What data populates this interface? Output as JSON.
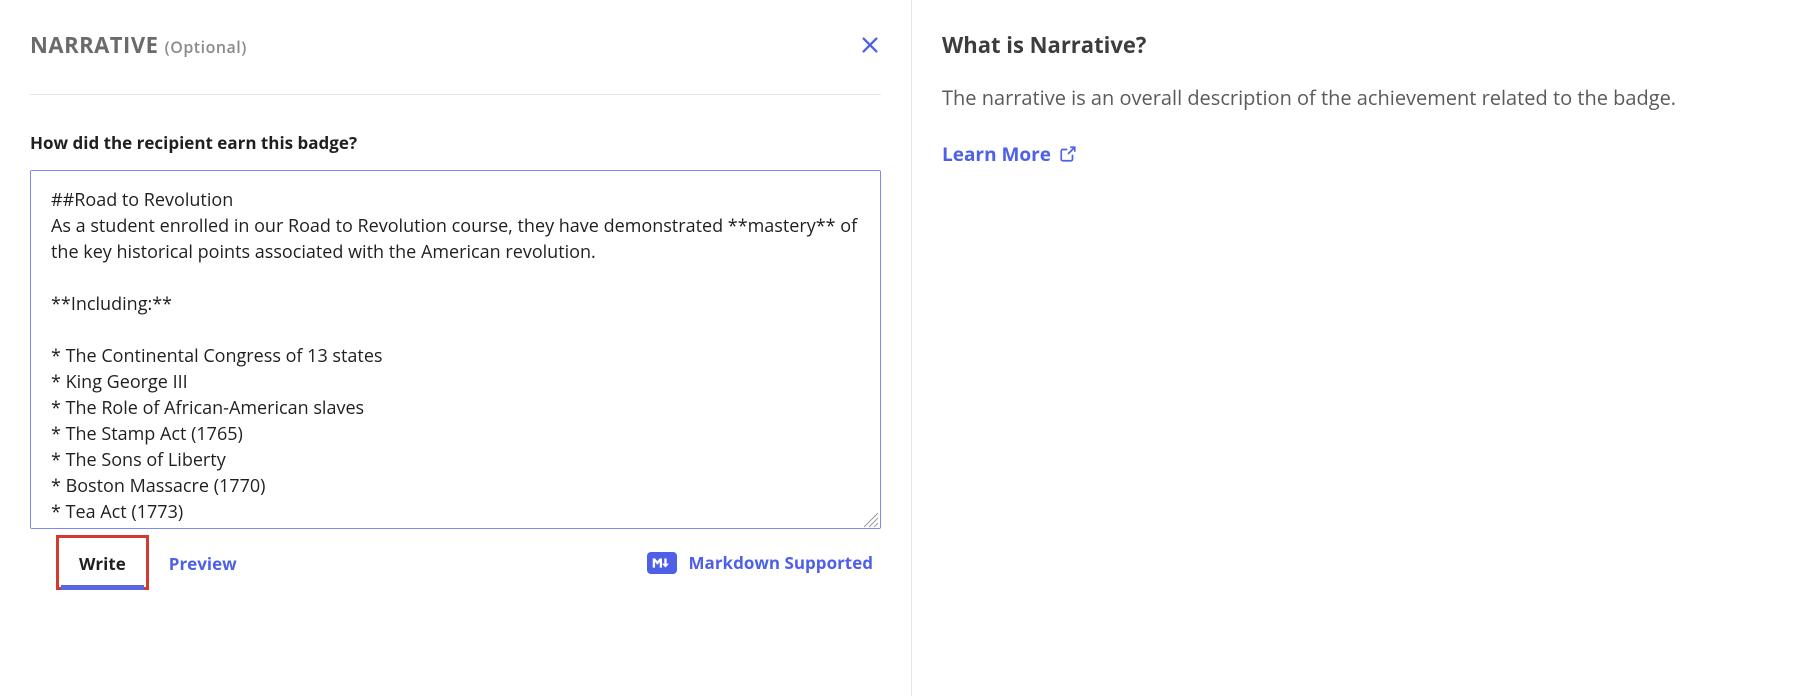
{
  "header": {
    "title_main": "NARRATIVE",
    "title_optional": "(Optional)"
  },
  "field": {
    "label": "How did the recipient earn this badge?",
    "value": "##Road to Revolution\nAs a student enrolled in our Road to Revolution course, they have demonstrated **mastery** of the key historical points associated with the American revolution.\n\n**Including:**\n\n* The Continental Congress of 13 states\n* King George III\n* The Role of African-American slaves\n* The Stamp Act (1765)\n* The Sons of Liberty\n* Boston Massacre (1770)\n* Tea Act (1773)"
  },
  "tabs": {
    "write": "Write",
    "preview": "Preview"
  },
  "markdown": {
    "label": "Markdown Supported"
  },
  "help": {
    "title": "What is Narrative?",
    "body": "The narrative is an overall description of the achievement related to the badge.",
    "learn_more": "Learn More"
  }
}
